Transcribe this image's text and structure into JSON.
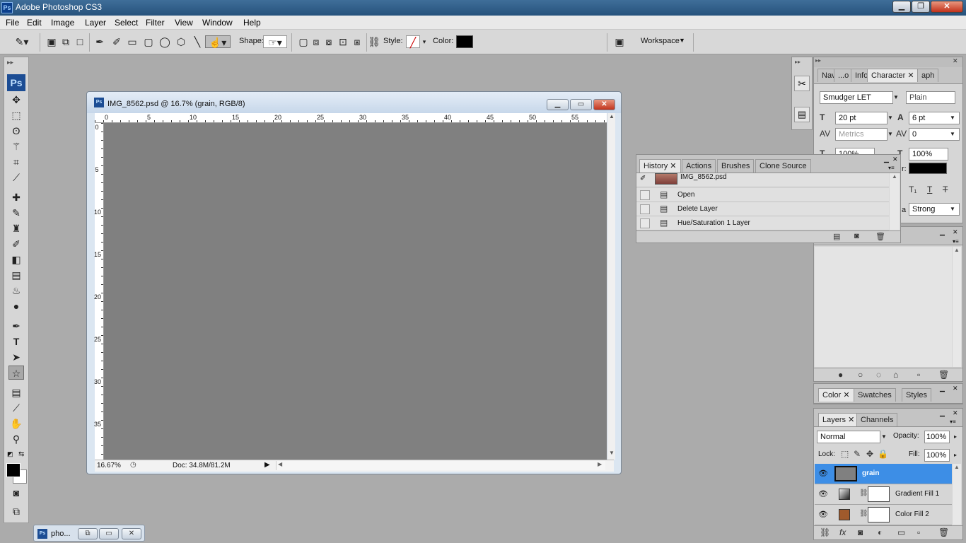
{
  "app": {
    "title": "Adobe Photoshop CS3",
    "logo": "Ps"
  },
  "menu": [
    "File",
    "Edit",
    "Image",
    "Layer",
    "Select",
    "Filter",
    "View",
    "Window",
    "Help"
  ],
  "options_bar": {
    "shape_label": "Shape:",
    "style_label": "Style:",
    "color_label": "Color:",
    "color_value": "#000000",
    "workspace_label": "Workspace",
    "tool_icon": "custom-shape-icon"
  },
  "document": {
    "title": "IMG_8562.psd @ 16.7% (grain, RGB/8)",
    "zoom": "16.67%",
    "doc_size": "Doc: 34.8M/81.2M",
    "ruler_h": [
      "0",
      "5",
      "10",
      "15",
      "20",
      "25",
      "30",
      "35",
      "40",
      "45",
      "50",
      "55"
    ],
    "ruler_v": [
      "0",
      "5",
      "10",
      "15",
      "20",
      "25",
      "30",
      "35"
    ],
    "canvas_color": "#808080"
  },
  "character_panel": {
    "tabs": [
      "Nav",
      "...o",
      "Info",
      "Character",
      "aph"
    ],
    "font_family": "Smudger LET",
    "font_style": "Plain",
    "font_size": "20 pt",
    "leading": "6 pt",
    "kerning": "Metrics",
    "tracking": "0",
    "vscale": "100%",
    "hscale": "100%",
    "color_label": "r:",
    "antialias": "Strong",
    "antialias_prefix": "a"
  },
  "history_panel": {
    "tabs": [
      "History",
      "Actions",
      "Brushes",
      "Clone Source"
    ],
    "snapshot": "IMG_8562.psd",
    "items": [
      "Open",
      "Delete Layer",
      "Hue/Saturation 1 Layer"
    ]
  },
  "color_panel": {
    "tabs": [
      "Color",
      "Swatches",
      "Styles"
    ]
  },
  "layers_panel": {
    "tabs": [
      "Layers",
      "Channels"
    ],
    "blend_mode": "Normal",
    "opacity_label": "Opacity:",
    "opacity": "100%",
    "lock_label": "Lock:",
    "fill_label": "Fill:",
    "fill": "100%",
    "layers": [
      {
        "name": "grain",
        "selected": true
      },
      {
        "name": "Gradient Fill 1",
        "selected": false
      },
      {
        "name": "Color Fill 2",
        "selected": false
      }
    ]
  },
  "taskbar": {
    "item": "pho..."
  }
}
